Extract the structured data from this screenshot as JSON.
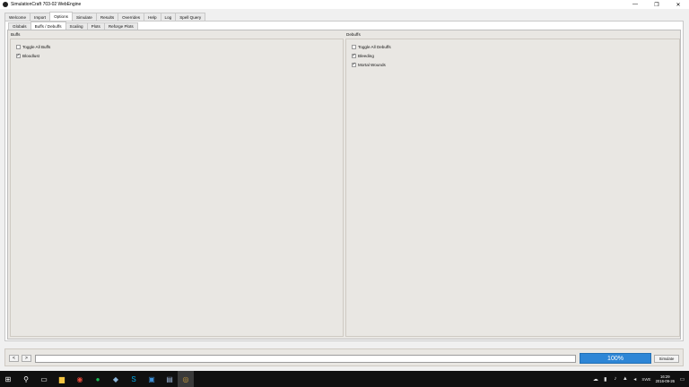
{
  "window": {
    "title": "SimulationCraft 703-02 WebEngine",
    "controls": {
      "minimize": "—",
      "restore": "❐",
      "close": "✕"
    }
  },
  "main_tabs": [
    "Welcome",
    "Import",
    "Options",
    "Simulate",
    "Results",
    "Overrides",
    "Help",
    "Log",
    "Spell Query"
  ],
  "main_tabs_active": "Options",
  "sub_tabs": [
    "Globals",
    "Buffs / Debuffs",
    "Scaling",
    "Plots",
    "Reforge Plots"
  ],
  "sub_tabs_active": "Buffs / Debuffs",
  "buffs": {
    "title": "Buffs",
    "items": [
      {
        "label": "Toggle All Buffs",
        "checked": false,
        "mark": ""
      },
      {
        "label": "Bloodlust",
        "checked": true,
        "mark": "✓"
      }
    ]
  },
  "debuffs": {
    "title": "Debuffs",
    "items": [
      {
        "label": "Toggle All Debuffs",
        "checked": false,
        "mark": ""
      },
      {
        "label": "Bleeding",
        "checked": true,
        "mark": "✓"
      },
      {
        "label": "Mortal Wounds",
        "checked": true,
        "mark": "✓"
      }
    ]
  },
  "bottom": {
    "back_label": "<",
    "forward_label": ">",
    "url_value": "",
    "progress_label": "100%",
    "progress": 1.0,
    "simulate_label": "Simulate"
  },
  "taskbar": {
    "time": "16:29",
    "date": "2016-09-26",
    "language": "SWE",
    "icons": [
      "windows-icon",
      "search-icon",
      "task-view-icon",
      "file-explorer-icon",
      "chrome-icon",
      "spotify-icon",
      "steam-icon",
      "skype-icon",
      "app-icon-1",
      "app-icon-2",
      "simc-icon"
    ]
  },
  "colors": {
    "progress": "#2e86d6",
    "panel_bg": "#e9e7e3",
    "taskbar": "#101010"
  }
}
